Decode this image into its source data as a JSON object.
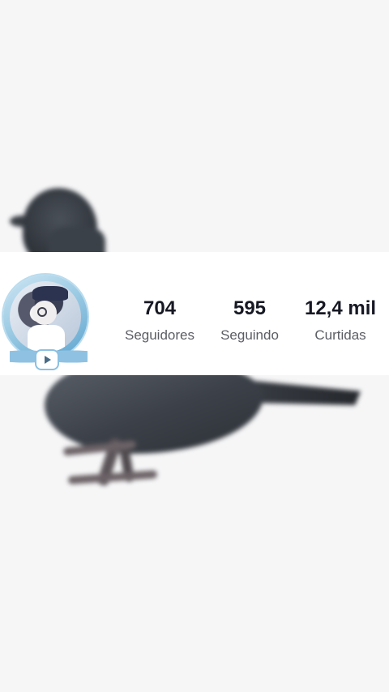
{
  "profile": {
    "stats": [
      {
        "value": "704",
        "label": "Seguidores"
      },
      {
        "value": "595",
        "label": "Seguindo"
      },
      {
        "value": "12,4 mil",
        "label": "Curtidas"
      }
    ]
  },
  "icons": {
    "avatar_badge": "play-icon"
  },
  "colors": {
    "stat_value": "#161823",
    "stat_label": "#5b5d64",
    "band_background": "#ffffff",
    "page_background": "#f6f6f7"
  }
}
